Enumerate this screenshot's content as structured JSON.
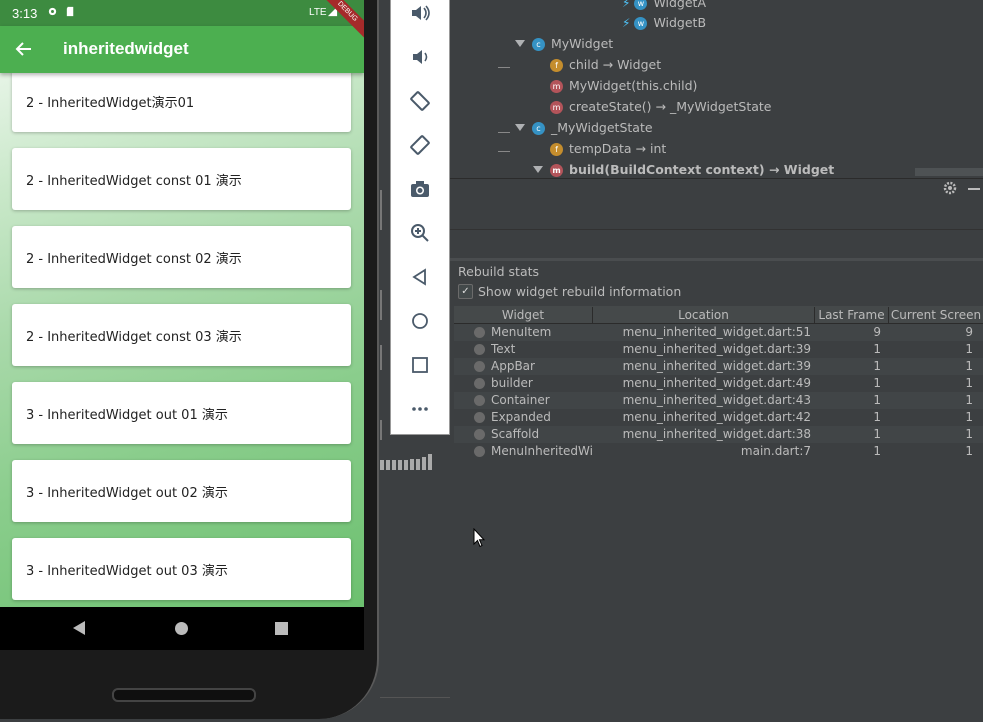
{
  "phone": {
    "status_time": "3:13",
    "status_network": "LTE",
    "appbar_title": "inheritedwidget",
    "debug_banner": "DEBUG",
    "cards": [
      "2 - InheritedWidget演示01",
      "2 - InheritedWidget const 01 演示",
      "2 - InheritedWidget const 02 演示",
      "2 - InheritedWidget const 03 演示",
      "3 - InheritedWidget out 01 演示",
      "3 - InheritedWidget out 02 演示",
      "3 - InheritedWidget out 03 演示"
    ]
  },
  "emulator_toolbar": {
    "icons": [
      "volume-up-icon",
      "volume-down-icon",
      "rotate-left-icon",
      "rotate-right-icon",
      "camera-icon",
      "zoom-icon",
      "back-icon",
      "home-icon",
      "overview-icon",
      "more-icon"
    ]
  },
  "structure": {
    "rows": [
      {
        "label": "WidgetA",
        "icon": "flutter"
      },
      {
        "label": "WidgetB",
        "icon": "flutter"
      },
      {
        "label": "MyWidget",
        "icon": "c"
      },
      {
        "label": "child → Widget",
        "icon": "f"
      },
      {
        "label": "MyWidget(this.child)",
        "icon": "m"
      },
      {
        "label": "createState() → _MyWidgetState",
        "icon": "m"
      },
      {
        "label": "_MyWidgetState",
        "icon": "c"
      },
      {
        "label": "tempData → int",
        "icon": "f"
      },
      {
        "label": "build(BuildContext context) → Widget",
        "icon": "m"
      }
    ]
  },
  "rebuild_stats": {
    "title": "Rebuild stats",
    "checkbox_label": "Show widget rebuild information",
    "checkbox_checked": true,
    "columns": [
      "Widget",
      "Location",
      "Last Frame",
      "Current Screen"
    ],
    "rows": [
      {
        "widget": "MenuItem",
        "location": "menu_inherited_widget.dart:51",
        "last": "9",
        "current": "9"
      },
      {
        "widget": "Text",
        "location": "menu_inherited_widget.dart:39",
        "last": "1",
        "current": "1"
      },
      {
        "widget": "AppBar",
        "location": "menu_inherited_widget.dart:39",
        "last": "1",
        "current": "1"
      },
      {
        "widget": "builder",
        "location": "menu_inherited_widget.dart:49",
        "last": "1",
        "current": "1"
      },
      {
        "widget": "Container",
        "location": "menu_inherited_widget.dart:43",
        "last": "1",
        "current": "1"
      },
      {
        "widget": "Expanded",
        "location": "menu_inherited_widget.dart:42",
        "last": "1",
        "current": "1"
      },
      {
        "widget": "Scaffold",
        "location": "menu_inherited_widget.dart:38",
        "last": "1",
        "current": "1"
      },
      {
        "widget": "MenuInheritedWi",
        "location": "main.dart:7",
        "last": "1",
        "current": "1"
      }
    ]
  }
}
